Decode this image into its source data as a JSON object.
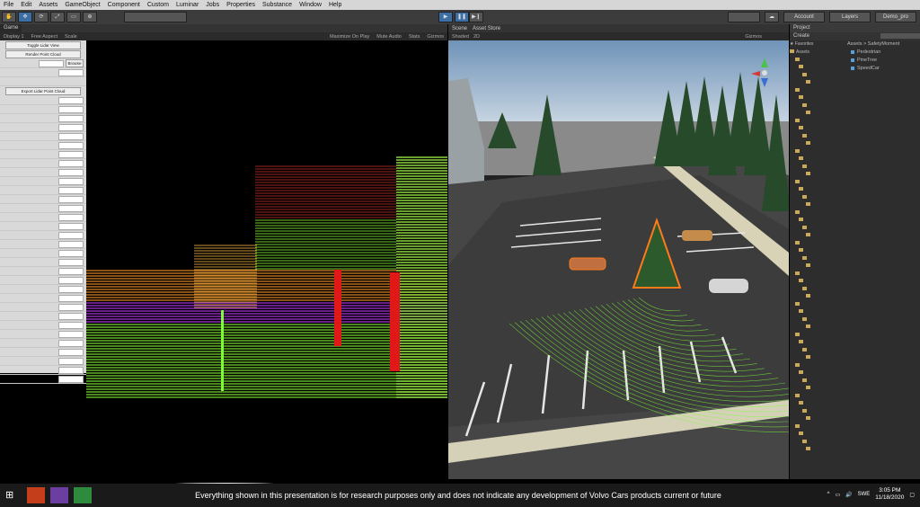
{
  "menu": [
    "File",
    "Edit",
    "Assets",
    "GameObject",
    "Component",
    "Custom",
    "Luminar",
    "Jobs",
    "Properties",
    "Substance",
    "Window",
    "Help"
  ],
  "toolbar": {
    "account": "Account",
    "layers": "Layers",
    "layout": "Demo_pro"
  },
  "game": {
    "tab": "Game",
    "display": "Display 1",
    "aspect": "Free Aspect",
    "scale": "Scale",
    "maximize": "Maximize On Play",
    "mute": "Mute Audio",
    "stats": "Stats",
    "gizmos": "Gizmos"
  },
  "sidepanel": {
    "buttons": [
      "Toggle Lidar View",
      "Render Point Cloud",
      "Export Lidar Point Cloud"
    ],
    "browse": "Browse"
  },
  "scene": {
    "tab": "Scene",
    "store": "Asset Store",
    "shaded": "Shaded",
    "mode": "2D",
    "gizmos": "Gizmos"
  },
  "project": {
    "tab": "Project",
    "create": "Create",
    "breadcrumb": "Assets > SafetyMoment",
    "favorites": "Favorites",
    "assets_root": "Assets",
    "files": [
      "Pedestrian",
      "PineTree",
      "SpeedCar"
    ]
  },
  "taskbar": {
    "disclaimer": "Everything shown in this presentation is for research purposes only and does not indicate any development of Volvo Cars products current or future",
    "lang": "SWE",
    "time": "3:05 PM",
    "date": "11/18/2020"
  },
  "colors": {
    "lidar_green": "#8cff3a",
    "lidar_red": "#e01818",
    "selection": "#ff7a1a"
  }
}
